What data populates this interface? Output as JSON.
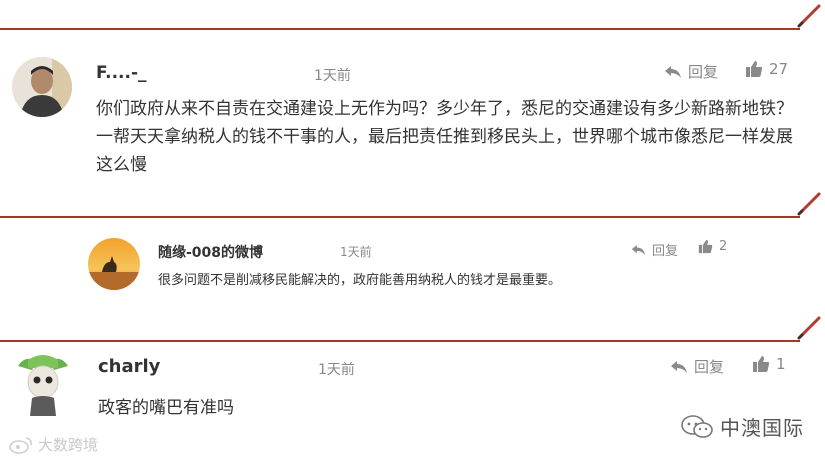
{
  "comments": [
    {
      "author": "F....-_",
      "time": "1天前",
      "reply_label": "回复",
      "likes": "27",
      "text": "你们政府从来不自责在交通建设上无作为吗？多少年了，悉尼的交通建设有多少新路新地铁？一帮天天拿纳税人的钱不干事的人，最后把责任推到移民头上，世界哪个城市像悉尼一样发展这么慢"
    },
    {
      "author": "随缘-008的微博",
      "time": "1天前",
      "reply_label": "回复",
      "likes": "2",
      "text": "很多问题不是削减移民能解决的，政府能善用纳税人的钱才是最重要。"
    },
    {
      "author": "charly",
      "time": "1天前",
      "reply_label": "回复",
      "likes": "1",
      "text": "政客的嘴巴有准吗"
    }
  ],
  "watermark_left": "大数跨境",
  "watermark_right": "中澳国际",
  "colors": {
    "divider": "#a6352b",
    "meta": "#888888",
    "text": "#333333"
  },
  "icons": [
    "pencil-icon",
    "reply-arrow-icon",
    "thumbs-up-icon",
    "wechat-icon",
    "weibo-icon"
  ]
}
